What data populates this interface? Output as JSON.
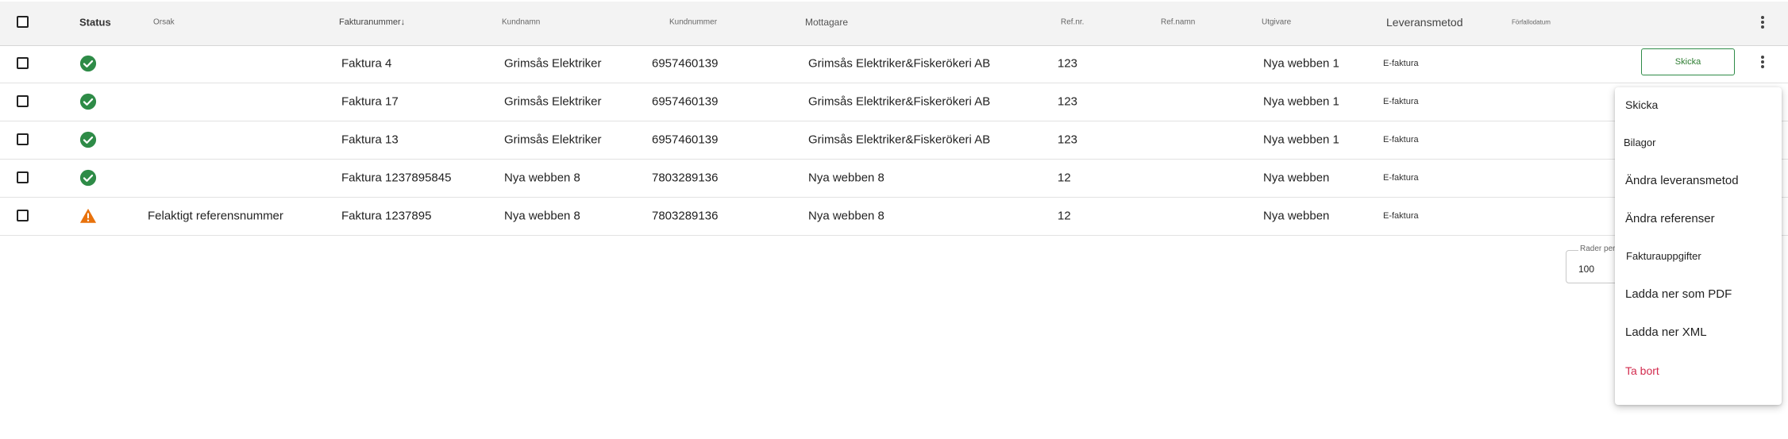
{
  "columns": {
    "status": "Status",
    "reason": "Orsak",
    "invoice_number": "Fakturanummer↓",
    "customer_name": "Kundnamn",
    "customer_number": "Kundnummer",
    "recipient": "Mottagare",
    "ref_nr": "Ref.nr.",
    "ref_name": "Ref.namn",
    "issuer": "Utgivare",
    "delivery_method": "Leveransmetod",
    "due_date": "Förfallodatum"
  },
  "rows": [
    {
      "status": "ok",
      "reason": "",
      "invoice": "Faktura 4",
      "customer_name": "Grimsås Elektriker",
      "customer_number": "6957460139",
      "recipient": "Grimsås Elektriker&Fiskerökeri AB",
      "ref_nr": "123",
      "ref_name": "",
      "issuer": "Nya webben 1",
      "delivery": "E-faktura"
    },
    {
      "status": "ok",
      "reason": "",
      "invoice": "Faktura 17",
      "customer_name": "Grimsås Elektriker",
      "customer_number": "6957460139",
      "recipient": "Grimsås Elektriker&Fiskerökeri AB",
      "ref_nr": "123",
      "ref_name": "",
      "issuer": "Nya webben 1",
      "delivery": "E-faktura"
    },
    {
      "status": "ok",
      "reason": "",
      "invoice": "Faktura 13",
      "customer_name": "Grimsås Elektriker",
      "customer_number": "6957460139",
      "recipient": "Grimsås Elektriker&Fiskerökeri AB",
      "ref_nr": "123",
      "ref_name": "",
      "issuer": "Nya webben 1",
      "delivery": "E-faktura"
    },
    {
      "status": "ok",
      "reason": "",
      "invoice": "Faktura 1237895845",
      "customer_name": "Nya webben 8",
      "customer_number": "7803289136",
      "recipient": "Nya webben 8",
      "ref_nr": "12",
      "ref_name": "",
      "issuer": "Nya webben",
      "delivery": "E-faktura"
    },
    {
      "status": "warning",
      "reason": "Felaktigt referensnummer",
      "invoice": "Faktura 1237895",
      "customer_name": "Nya webben 8",
      "customer_number": "7803289136",
      "recipient": "Nya webben 8",
      "ref_nr": "12",
      "ref_name": "",
      "issuer": "Nya webben",
      "delivery": "E-faktura"
    }
  ],
  "row_action": {
    "send_label": "Skicka"
  },
  "pagination": {
    "rows_per_page_label": "Rader per",
    "rows_per_page_value": "100"
  },
  "context_menu": {
    "items": [
      {
        "label": "Skicka",
        "type": "normal"
      },
      {
        "label": "Bilagor",
        "type": "normal"
      },
      {
        "label": "Ändra leveransmetod",
        "type": "normal"
      },
      {
        "label": "Ändra referenser",
        "type": "normal"
      },
      {
        "label": "Fakturauppgifter",
        "type": "normal"
      },
      {
        "label": "Ladda ner som PDF",
        "type": "normal"
      },
      {
        "label": "Ladda ner XML",
        "type": "normal"
      },
      {
        "label": "Ta bort",
        "type": "danger"
      }
    ]
  },
  "icons": {
    "ok": "check-circle-icon",
    "warning": "warning-triangle-icon",
    "more": "more-vert-icon"
  },
  "colors": {
    "ok": "#2e8b47",
    "warning": "#e8720c",
    "danger": "#d22b4e",
    "accent_border": "#2e8b47"
  }
}
